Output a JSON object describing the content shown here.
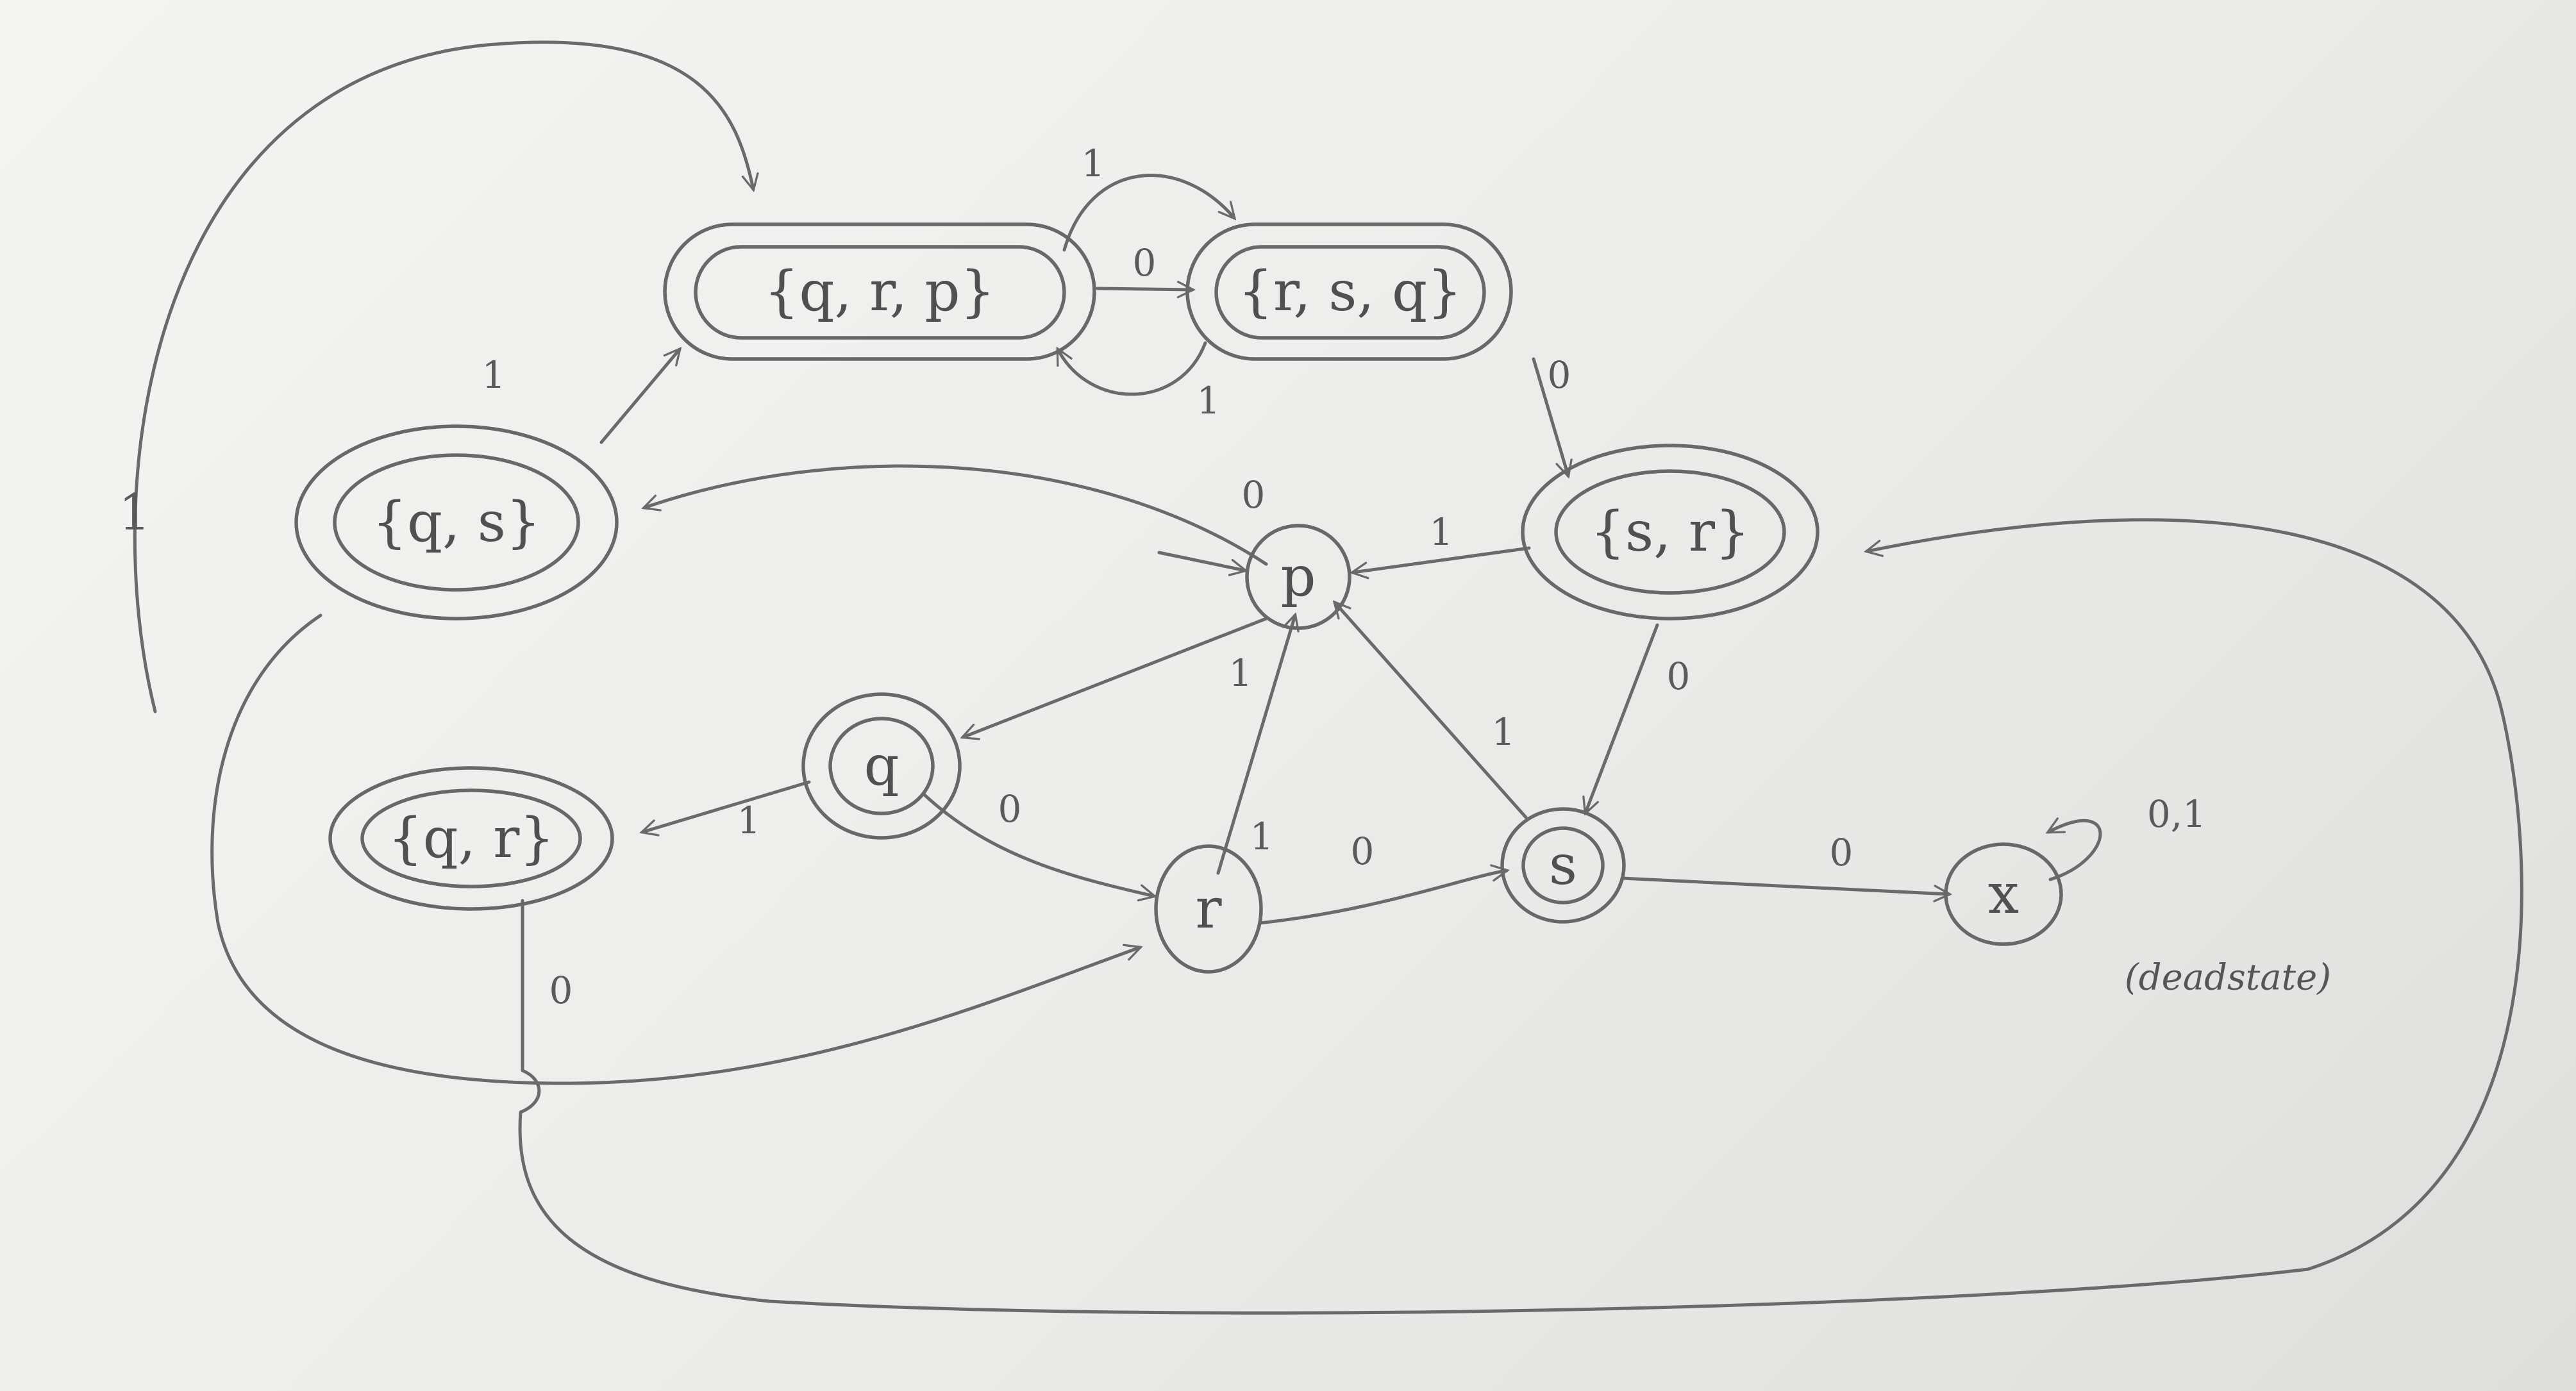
{
  "diagram": {
    "states": {
      "qrp": "{q, r, p}",
      "rsq": "{r, s, q}",
      "qs": "{q, s}",
      "sr": "{s, r}",
      "qr": "{q, r}",
      "p": "p",
      "q": "q",
      "r": "r",
      "s": "s",
      "x": "x"
    },
    "edge_labels": {
      "top_loop_1": "1",
      "qrp_rsq_0": "0",
      "qrp_rsq_1": "1",
      "rsq_qrp_1": "1",
      "qs_qrp_1": "1",
      "rsq_sr_0": "0",
      "p_qs_0": "0",
      "sr_p_1": "1",
      "sr_s_0": "0",
      "p_q_1": "1",
      "q_qr_1": "1",
      "q_r_0": "0",
      "r_p_1": "1",
      "r_s_0": "0",
      "s_p_1": "1",
      "s_x_0": "0",
      "x_self": "0,1",
      "qr_r_0": "0"
    },
    "annotations": {
      "dead_state": "(deadstate)"
    }
  }
}
